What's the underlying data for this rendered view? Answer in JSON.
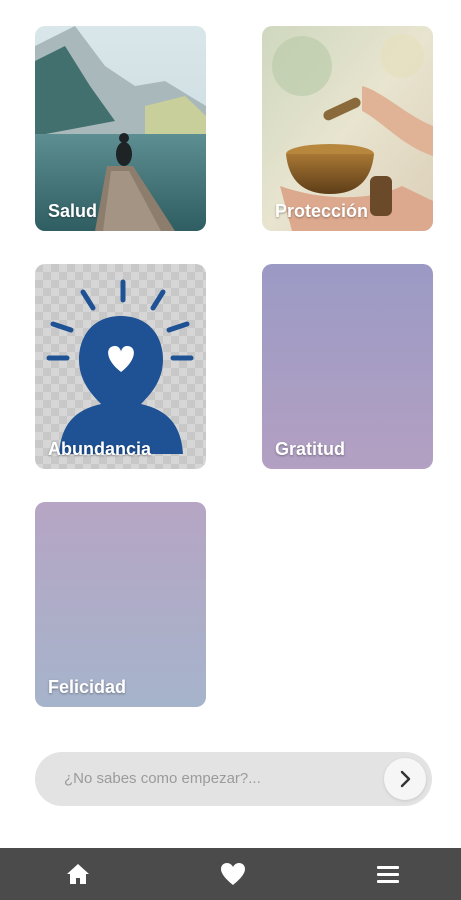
{
  "categories": [
    {
      "label": "Salud"
    },
    {
      "label": "Protección"
    },
    {
      "label": "Abundancia"
    },
    {
      "label": "Gratitud"
    },
    {
      "label": "Felicidad"
    }
  ],
  "search": {
    "placeholder": "¿No sabes como empezar?...",
    "button_icon": "chevron-right-icon"
  },
  "bottom_nav": {
    "items": [
      {
        "icon": "home-icon"
      },
      {
        "icon": "heart-icon"
      },
      {
        "icon": "menu-icon"
      }
    ],
    "background": "#4b4b4b"
  },
  "colors": {
    "gratitud_gradient": [
      "#9b9ac5",
      "#b3a0c2"
    ],
    "felicidad_gradient": [
      "#b6a5c4",
      "#a6b4cb"
    ],
    "abundancia_icon": "#1f5294"
  }
}
